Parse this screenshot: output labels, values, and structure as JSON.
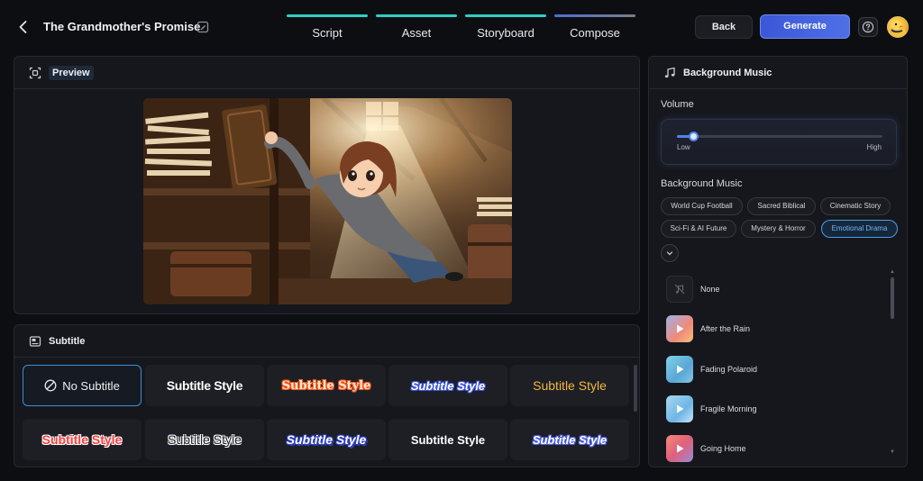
{
  "header": {
    "project_title": "The Grandmother's Promise",
    "steps": [
      {
        "label": "Script"
      },
      {
        "label": "Asset"
      },
      {
        "label": "Storyboard"
      },
      {
        "label": "Compose"
      }
    ],
    "back_label": "Back",
    "generate_label": "Generate"
  },
  "preview": {
    "title": "Preview"
  },
  "subtitle": {
    "title": "Subtitle",
    "styles": [
      {
        "label": "No Subtitle"
      },
      {
        "label": "Subtitle Style"
      },
      {
        "label": "Subtitle Style"
      },
      {
        "label": "Subtitle Style"
      },
      {
        "label": "Subtitle Style"
      },
      {
        "label": "Subtitle Style"
      },
      {
        "label": "Subtitle Style"
      },
      {
        "label": "Subtitle Style"
      },
      {
        "label": "Subtitle Style"
      },
      {
        "label": "Subtitle Style"
      }
    ]
  },
  "music": {
    "title": "Background Music",
    "volume_label": "Volume",
    "volume_value": 0.08,
    "low_label": "Low",
    "high_label": "High",
    "section_label": "Background Music",
    "categories": [
      {
        "label": "World Cup Football"
      },
      {
        "label": "Sacred Biblical"
      },
      {
        "label": "Cinematic Story"
      },
      {
        "label": "Sci-Fi & AI Future"
      },
      {
        "label": "Mystery & Horror"
      },
      {
        "label": "Emotional Drama"
      }
    ],
    "selected_category": "Emotional Drama",
    "tracks": [
      {
        "name": "None"
      },
      {
        "name": "After the Rain"
      },
      {
        "name": "Fading Polaroid"
      },
      {
        "name": "Fragile Morning"
      },
      {
        "name": "Going Home"
      }
    ]
  },
  "colors": {
    "accent": "#4f6fe6",
    "teal": "#2bd1c3",
    "selected_border": "#4a9ce6"
  }
}
